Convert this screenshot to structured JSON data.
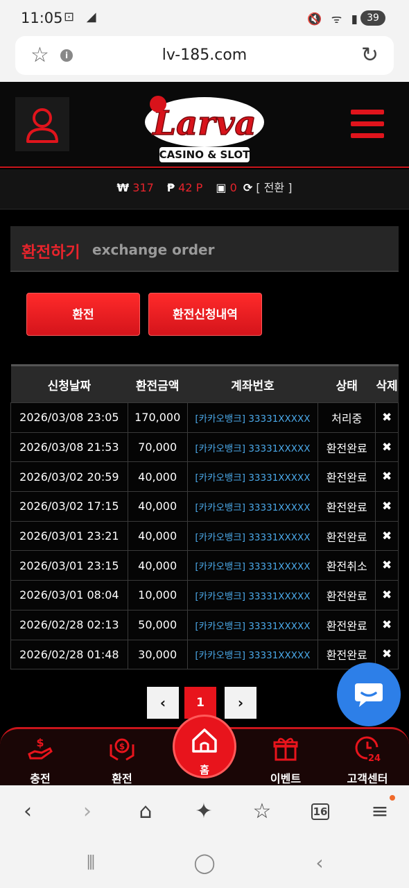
{
  "status_bar": {
    "time": "11:05",
    "battery": "39"
  },
  "browser": {
    "url": "lv-185.com",
    "tab_count": "16"
  },
  "header": {
    "logo_text": "Larva",
    "logo_sub": "CASINO & SLOT"
  },
  "balance": {
    "won_symbol": "₩",
    "won_value": "317",
    "point_symbol": "₱",
    "point_value": "42 P",
    "chip_value": "0",
    "convert_label": "[ 전환 ]"
  },
  "page": {
    "title_ko": "환전하기",
    "title_en": "exchange order"
  },
  "buttons": {
    "exchange": "환전",
    "history": "환전신청내역"
  },
  "table": {
    "headers": [
      "신청날짜",
      "환전금액",
      "계좌번호",
      "상태",
      "삭제"
    ],
    "rows": [
      {
        "date": "2026/03/08 23:05",
        "amount": "170,000",
        "account": "[카카오뱅크] 33331XXXXX",
        "status": "처리중",
        "delete": "✖"
      },
      {
        "date": "2026/03/08 21:53",
        "amount": "70,000",
        "account": "[카카오뱅크] 33331XXXXX",
        "status": "환전완료",
        "delete": "✖"
      },
      {
        "date": "2026/03/02 20:59",
        "amount": "40,000",
        "account": "[카카오뱅크] 33331XXXXX",
        "status": "환전완료",
        "delete": "✖"
      },
      {
        "date": "2026/03/02 17:15",
        "amount": "40,000",
        "account": "[카카오뱅크] 33331XXXXX",
        "status": "환전완료",
        "delete": "✖"
      },
      {
        "date": "2026/03/01 23:21",
        "amount": "40,000",
        "account": "[카카오뱅크] 33331XXXXX",
        "status": "환전완료",
        "delete": "✖"
      },
      {
        "date": "2026/03/01 23:15",
        "amount": "40,000",
        "account": "[카카오뱅크] 33331XXXXX",
        "status": "환전취소",
        "delete": "✖"
      },
      {
        "date": "2026/03/01 08:04",
        "amount": "10,000",
        "account": "[카카오뱅크] 33331XXXXX",
        "status": "환전완료",
        "delete": "✖"
      },
      {
        "date": "2026/02/28 02:13",
        "amount": "50,000",
        "account": "[카카오뱅크] 33331XXXXX",
        "status": "환전완료",
        "delete": "✖"
      },
      {
        "date": "2026/02/28 01:48",
        "amount": "30,000",
        "account": "[카카오뱅크] 33331XXXXX",
        "status": "환전완료",
        "delete": "✖"
      }
    ]
  },
  "pagination": {
    "prev": "‹",
    "current": "1",
    "next": "›"
  },
  "bottom_nav": {
    "deposit": "충전",
    "exchange": "환전",
    "home": "홈",
    "event": "이벤트",
    "support": "고객센터"
  },
  "colors": {
    "accent": "#e8141c",
    "link": "#4aa8e8",
    "chat": "#2d7fe8"
  }
}
